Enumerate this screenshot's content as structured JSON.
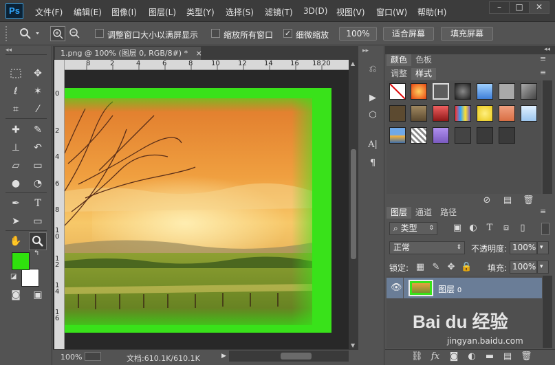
{
  "app": {
    "logo": "Ps"
  },
  "menu": [
    "文件(F)",
    "编辑(E)",
    "图像(I)",
    "图层(L)",
    "类型(Y)",
    "选择(S)",
    "滤镜(T)",
    "3D(D)",
    "视图(V)",
    "窗口(W)",
    "帮助(H)"
  ],
  "window_controls": {
    "minimize": "–",
    "maximize": "□",
    "close": "✕"
  },
  "options_bar": {
    "resize_windows_label": "调整窗口大小以满屏显示",
    "resize_windows_checked": false,
    "zoom_all_label": "缩放所有窗口",
    "zoom_all_checked": false,
    "scrubby_zoom_label": "细微缩放",
    "scrubby_zoom_checked": true,
    "zoom_100_button": "100%",
    "fit_screen_button": "适合屏幕",
    "fill_screen_button": "填充屏幕"
  },
  "document": {
    "tab_title": "1.png @ 100% (图层 0, RGB/8#) *",
    "close_glyph": "×",
    "ruler_top_ticks": [
      "8",
      "2",
      "4",
      "6",
      "8",
      "10",
      "12",
      "14",
      "16",
      "18",
      "20"
    ],
    "ruler_left_ticks": [
      "0",
      "2",
      "4",
      "6",
      "8",
      "1 0",
      "1 2",
      "1 4",
      "1 6"
    ]
  },
  "status": {
    "zoom": "100%",
    "doc_info": "文档:610.1K/610.1K"
  },
  "colors": {
    "foreground": "#2fe10d",
    "background": "#ffffff",
    "canvas_border": "#39e21a",
    "selected_layer": "#6a7d97",
    "app_bg": "#535353"
  },
  "panels": {
    "color_tabs": [
      "颜色",
      "色板"
    ],
    "adjust_tabs": [
      "调整",
      "样式"
    ],
    "layers_tabs": [
      "图层",
      "通道",
      "路径"
    ],
    "layer_filter": "类型",
    "blend_mode": "正常",
    "opacity_label": "不透明度:",
    "opacity_value": "100%",
    "lock_label": "锁定:",
    "fill_label": "填充:",
    "fill_value": "100%",
    "layers": [
      {
        "name": "图层",
        "suffix": "0",
        "visible": true,
        "selected": true
      }
    ]
  },
  "styles_swatches": [
    "#ffffff",
    "#e8410e",
    "#5d5d5d",
    "#202020",
    "#3f7fd9",
    "#a9a9a9",
    "#6d6d6d",
    "#5c4a30",
    "#7a6440",
    "#c03232",
    "#6a58c8",
    "#e9c81a",
    "#d96f44",
    "#9cc6ee",
    "#3f6ea8",
    "#cfcfcf",
    "#7a5ac0",
    "#444444",
    "#3a3a3a",
    "#3a3a3a"
  ],
  "watermark": {
    "brand": "Bai du 经验",
    "url": "jingyan.baidu.com"
  }
}
